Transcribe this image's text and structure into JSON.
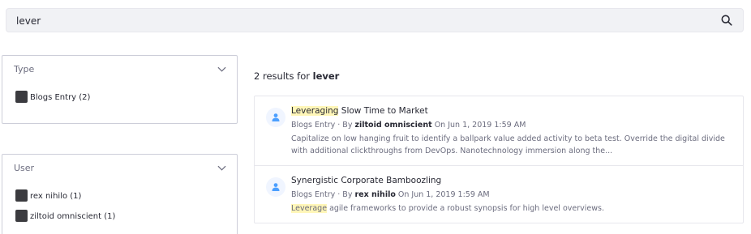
{
  "search": {
    "value": "lever",
    "placeholder": ""
  },
  "facets": {
    "type": {
      "title": "Type",
      "options": [
        {
          "label": "Blogs Entry (2)"
        }
      ]
    },
    "user": {
      "title": "User",
      "options": [
        {
          "label": "rex nihilo (1)"
        },
        {
          "label": "ziltoid omniscient (1)"
        }
      ]
    }
  },
  "results_summary": {
    "prefix": "2 results for",
    "keyword": "lever"
  },
  "results": [
    {
      "title_highlight": "Leveraging",
      "title_rest": " Slow Time to Market",
      "type": "Blogs Entry",
      "by": " · By ",
      "author": "ziltoid omniscient",
      "date": " On Jun 1, 2019 1:59 AM",
      "desc_highlight": "",
      "desc_rest": "Capitalize on low hanging fruit to identify a ballpark value added activity to beta test. Override the digital divide with additional clickthroughs from DevOps. Nanotechnology immersion along the..."
    },
    {
      "title_highlight": "",
      "title_rest": "Synergistic Corporate Bamboozling",
      "type": "Blogs Entry",
      "by": " · By ",
      "author": "rex nihilo",
      "date": " On Jun 1, 2019 1:59 AM",
      "desc_highlight": "Leverage",
      "desc_rest": " agile frameworks to provide a robust synopsis for high level overviews."
    }
  ],
  "icons": {
    "search": "search-icon",
    "chevron": "chevron-down-icon",
    "avatar": "user-icon",
    "checkbox": "checkbox"
  },
  "colors": {
    "highlight": "#fff6b8",
    "avatar_bg": "#f0f5ff",
    "avatar_fg": "#4b9fff",
    "checkbox": "#3b3b3f"
  }
}
